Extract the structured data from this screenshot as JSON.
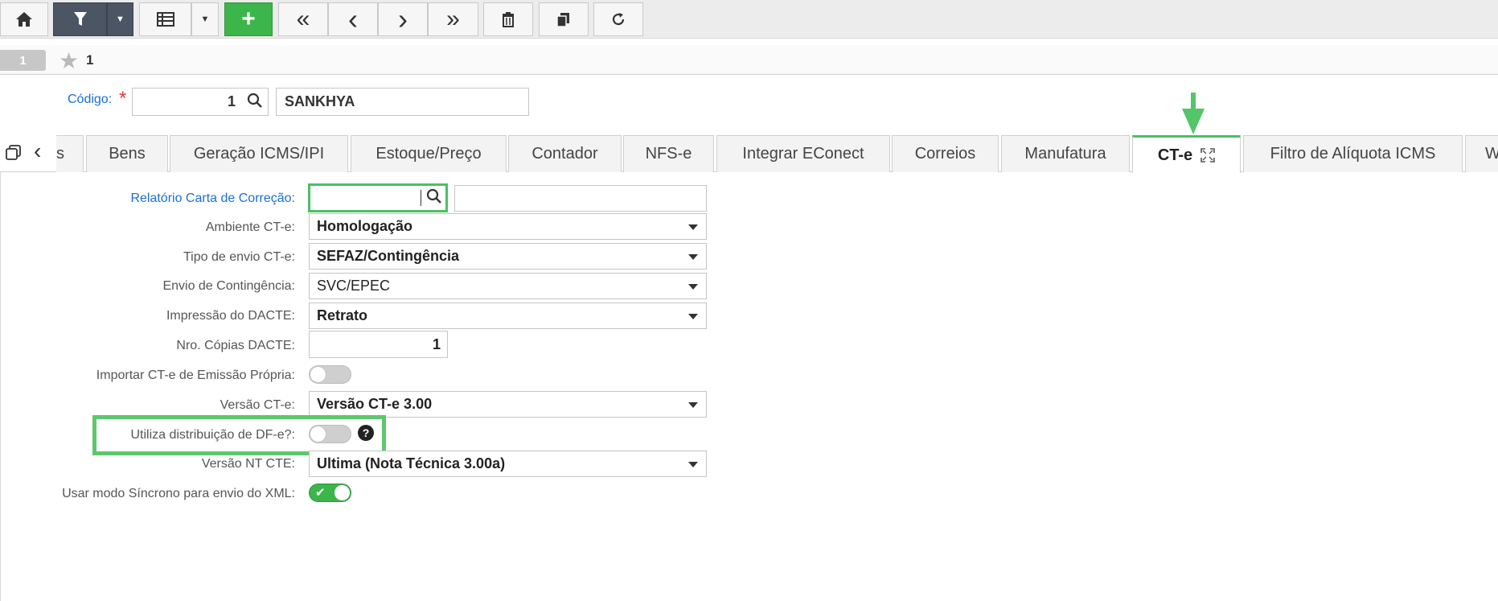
{
  "toolbar": {
    "home_icon": "home-icon",
    "filter_icon": "filter-icon",
    "grid_icon": "grid-view-icon",
    "add_label": "+",
    "first_label": "«",
    "prev_label": "‹",
    "next_label": "›",
    "last_label": "»",
    "colors": {
      "filter_bg": "#4b5563",
      "add_bg": "#3cb54a"
    }
  },
  "record_bar": {
    "record_number": "1",
    "favorites_count": "1"
  },
  "header": {
    "codigo_label": "Código:",
    "codigo_value": "1",
    "codigo_name": "SANKHYA"
  },
  "tabs": [
    {
      "label": "s"
    },
    {
      "label": "Bens"
    },
    {
      "label": "Geração ICMS/IPI"
    },
    {
      "label": "Estoque/Preço"
    },
    {
      "label": "Contador"
    },
    {
      "label": "NFS-e"
    },
    {
      "label": "Integrar EConect"
    },
    {
      "label": "Correios"
    },
    {
      "label": "Manufatura"
    },
    {
      "label": "CT-e",
      "active": true
    },
    {
      "label": "Filtro de Alíquota ICMS"
    },
    {
      "label": "W"
    }
  ],
  "form": {
    "relatorio_label": "Relatório Carta de Correção:",
    "ambiente_label": "Ambiente CT-e:",
    "ambiente_value": "Homologação",
    "tipo_envio_label": "Tipo de envio CT-e:",
    "tipo_envio_value": "SEFAZ/Contingência",
    "envio_cont_label": "Envio de Contingência:",
    "envio_cont_value": "SVC/EPEC",
    "impressao_label": "Impressão do DACTE:",
    "impressao_value": "Retrato",
    "copias_label": "Nro. Cópias DACTE:",
    "copias_value": "1",
    "importar_label": "Importar CT-e de Emissão Própria:",
    "versao_label": "Versão CT-e:",
    "versao_value": "Versão CT-e 3.00",
    "dfe_label": "Utiliza distribuição de DF-e?:",
    "versao_nt_label": "Versão NT CTE:",
    "versao_nt_value": "Ultima (Nota Técnica 3.00a)",
    "sincrono_label": "Usar modo Síncrono para envio do XML:",
    "help_glyph": "?",
    "accent_color": "#49c163"
  }
}
